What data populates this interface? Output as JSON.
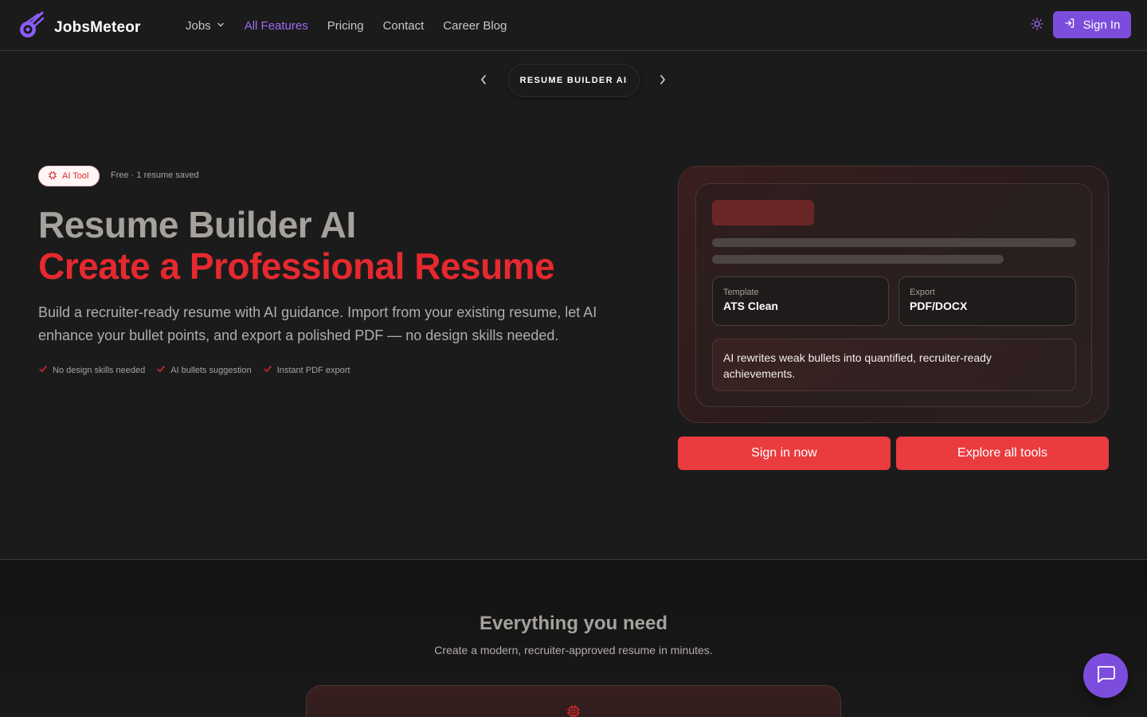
{
  "brand": {
    "name": "JobsMeteor",
    "logo_icon": "meteor-logo-icon",
    "accent": "#7c4ddd"
  },
  "nav": {
    "items": [
      {
        "label": "Jobs",
        "has_dropdown": true,
        "active": false
      },
      {
        "label": "All Features",
        "active": true
      },
      {
        "label": "Pricing",
        "active": false
      },
      {
        "label": "Contact",
        "active": false
      },
      {
        "label": "Career Blog",
        "active": false
      }
    ],
    "theme_icon": "sun-icon",
    "signin_label": "Sign In"
  },
  "carousel": {
    "label": "RESUME BUILDER AI",
    "prev_icon": "chevron-left-icon",
    "next_icon": "chevron-right-icon"
  },
  "hero": {
    "badge_label": "AI Tool",
    "badge_note": "Free · 1 resume saved",
    "title": "Resume Builder AI",
    "subtitle": "Create a Professional Resume",
    "description": "Build a recruiter-ready resume with AI guidance. Import from your existing resume, let AI enhance your bullet points, and export a polished PDF — no design skills needed.",
    "checks": [
      "No design skills needed",
      "AI bullets suggestion",
      "Instant PDF export"
    ],
    "accent": "#e5292f"
  },
  "preview": {
    "template_label": "Template",
    "template_value": "ATS Clean",
    "export_label": "Export",
    "export_value": "PDF/DOCX",
    "ai_note": "AI rewrites weak bullets into quantified, recruiter-ready achievements."
  },
  "cta": {
    "primary": "Sign in now",
    "secondary": "Explore all tools",
    "color": "#ea3b3f"
  },
  "features": {
    "title": "Everything you need",
    "subtitle": "Create a modern, recruiter-approved resume in minutes.",
    "card_icon": "chip-icon"
  },
  "chat": {
    "icon": "chat-icon"
  }
}
